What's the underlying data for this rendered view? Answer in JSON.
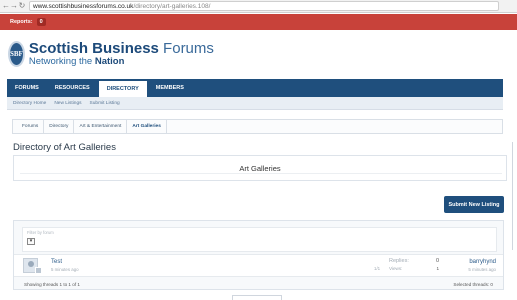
{
  "browser": {
    "back_icon": "arrow-left-icon",
    "forward_icon": "arrow-right-icon",
    "reload_icon": "reload-icon",
    "url_host": "www.scottishbusinessforums.co.uk",
    "url_path": "/directory/art-galleries.108/"
  },
  "topbar": {
    "reports_label": "Reports:",
    "reports_count": "0",
    "color": "#c8423a"
  },
  "logo": {
    "emblem": "SBF",
    "name_bold": "Scottish Business",
    "name_light": " Forums",
    "tagline_prefix": "Networking the ",
    "tagline_bold": "Nation"
  },
  "nav": {
    "tabs": [
      {
        "label": "FORUMS",
        "active": false
      },
      {
        "label": "RESOURCES",
        "active": false
      },
      {
        "label": "DIRECTORY",
        "active": true
      },
      {
        "label": "MEMBERS",
        "active": false
      }
    ],
    "color": "#1f4f7d"
  },
  "subnav": {
    "items": [
      "Directory Home",
      "New Listings",
      "Submit Listing"
    ]
  },
  "breadcrumb": [
    "Forums",
    "Directory",
    "Art & Entertainment",
    "Art Galleries"
  ],
  "page": {
    "title": "Directory of Art Galleries",
    "category_name": "Art Galleries",
    "post_button": "Submit New Listing"
  },
  "filter": {
    "label": "Filter by forum",
    "toggle_icon": "square-icon"
  },
  "threads": [
    {
      "title": "Test",
      "meta": "5 minutes ago",
      "count": "1/1",
      "replies_label": "Replies:",
      "replies_value": "0",
      "views_label": "Views:",
      "views_value": "1",
      "last_user": "barryhynd",
      "last_time": "5 minutes ago"
    }
  ],
  "footer": {
    "showing": "Showing threads 1 to 1 of 1",
    "selected": "Selected threads: 0"
  }
}
